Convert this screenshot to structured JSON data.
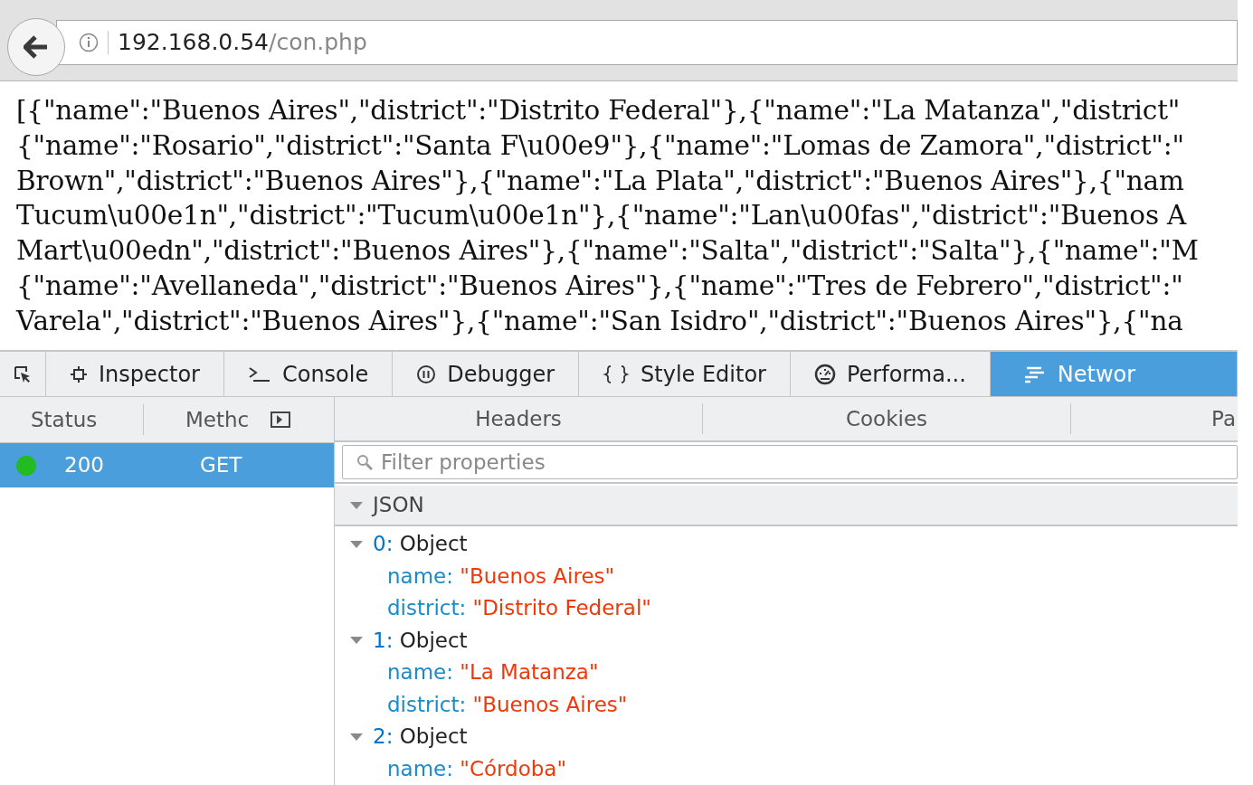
{
  "address_bar": {
    "host": "192.168.0.54",
    "path": "/con.php"
  },
  "page_lines": [
    "[{\"name\":\"Buenos Aires\",\"district\":\"Distrito Federal\"},{\"name\":\"La Matanza\",\"district\"",
    "{\"name\":\"Rosario\",\"district\":\"Santa F\\u00e9\"},{\"name\":\"Lomas de Zamora\",\"district\":\"",
    "Brown\",\"district\":\"Buenos Aires\"},{\"name\":\"La Plata\",\"district\":\"Buenos Aires\"},{\"nam",
    "Tucum\\u00e1n\",\"district\":\"Tucum\\u00e1n\"},{\"name\":\"Lan\\u00fas\",\"district\":\"Buenos A",
    "Mart\\u00edn\",\"district\":\"Buenos Aires\"},{\"name\":\"Salta\",\"district\":\"Salta\"},{\"name\":\"M",
    "{\"name\":\"Avellaneda\",\"district\":\"Buenos Aires\"},{\"name\":\"Tres de Febrero\",\"district\":\"",
    "Varela\",\"district\":\"Buenos Aires\"},{\"name\":\"San Isidro\",\"district\":\"Buenos Aires\"},{\"na"
  ],
  "devtools_tabs": [
    {
      "kind": "picker",
      "selected": false
    },
    {
      "kind": "inspector",
      "label": "Inspector",
      "selected": false
    },
    {
      "kind": "console",
      "label": "Console",
      "selected": false
    },
    {
      "kind": "debugger",
      "label": "Debugger",
      "selected": false
    },
    {
      "kind": "style",
      "label": "Style Editor",
      "selected": false
    },
    {
      "kind": "performance",
      "label": "Performa...",
      "selected": false
    },
    {
      "kind": "network",
      "label": "Networ",
      "selected": true
    }
  ],
  "request_columns": [
    "Status",
    "Methc"
  ],
  "requests": [
    {
      "status": "200",
      "method": "GET",
      "color": "#22bb22",
      "selected": true
    }
  ],
  "detail_tabs": [
    {
      "label": "Headers",
      "selected": false
    },
    {
      "label": "Cookies",
      "selected": false
    },
    {
      "label": "Pa",
      "selected": false
    }
  ],
  "filter": {
    "placeholder": "Filter properties"
  },
  "json_section": {
    "label": "JSON",
    "expanded": true
  },
  "tree": [
    {
      "index": "0:",
      "type": "Object",
      "expanded": true,
      "children": [
        {
          "key": "name:",
          "value": "\"Buenos Aires\""
        },
        {
          "key": "district:",
          "value": "\"Distrito Federal\""
        }
      ]
    },
    {
      "index": "1:",
      "type": "Object",
      "expanded": true,
      "children": [
        {
          "key": "name:",
          "value": "\"La Matanza\""
        },
        {
          "key": "district:",
          "value": "\"Buenos Aires\""
        }
      ]
    },
    {
      "index": "2:",
      "type": "Object",
      "expanded": true,
      "children": [
        {
          "key": "name:",
          "value": "\"Córdoba\""
        }
      ]
    }
  ]
}
